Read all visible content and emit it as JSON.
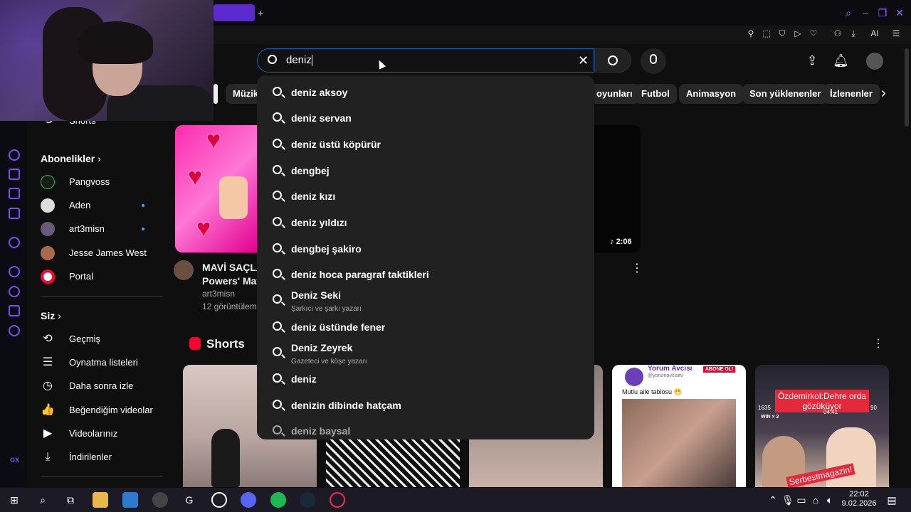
{
  "search": {
    "query": "deniz"
  },
  "suggestions": [
    {
      "text": "deniz aksoy"
    },
    {
      "text": "deniz servan"
    },
    {
      "text": "deniz üstü köpürür"
    },
    {
      "text": "dengbej"
    },
    {
      "text": "deniz kızı"
    },
    {
      "text": "deniz yıldızı"
    },
    {
      "text": "dengbej şakiro"
    },
    {
      "text": "deniz hoca paragraf taktikleri"
    },
    {
      "text": "Deniz Seki",
      "sub": "Şarkıcı ve şarkı yazarı"
    },
    {
      "text": "deniz üstünde fener"
    },
    {
      "text": "Deniz Zeyrek",
      "sub": "Gazeteci ve köşe yazarı"
    },
    {
      "text": "deniz"
    },
    {
      "text": "denizin dibinde hatçam"
    },
    {
      "text": "deniz baysal"
    }
  ],
  "chips": [
    "Müzik",
    "oyunları",
    "Futbol",
    "Animasyon",
    "Son yüklenenler",
    "İzlenenler"
  ],
  "sidebar": {
    "shorts_label": "Shorts",
    "subs_heading": "Abonelikler",
    "subscriptions": [
      "Pangvoss",
      "Aden",
      "art3misn",
      "Jesse James West",
      "Portal"
    ],
    "you_heading": "Siz",
    "you_items": [
      "Geçmiş",
      "Oynatma listeleri",
      "Daha sonra izle",
      "Beğendiğim videolar",
      "Videolarınız",
      "İndirilenler"
    ]
  },
  "video": {
    "title_line1": "MAVİ SAÇLA",
    "title_line2": "Powers' Matc",
    "channel": "art3misn",
    "views": "12 görüntüleme",
    "duration": "2:06"
  },
  "shorts": {
    "heading": "Shorts",
    "card4_channel": "Yorum Avcısı",
    "card4_handle": "@yorumavcisitv",
    "card4_badge": "ABONE OL!",
    "card4_caption": "Mutlu aile tablosu 😁",
    "card5_banner": "Özdemirkol:Dehre orda gözüküyor",
    "card5_watermark": "Serbestmagazin!",
    "card5_time": "04:41",
    "card5_left": "1635",
    "card5_score": "90",
    "card5_win": "WIN × 2"
  },
  "browser": {
    "ai_label": "AI",
    "gx_label": "GX"
  },
  "taskbar": {
    "time": "22:02",
    "date": "9.02.2026"
  },
  "colors": {
    "accent": "#7b4cff",
    "search_border": "#1c62b9",
    "red": "#ff0033"
  }
}
